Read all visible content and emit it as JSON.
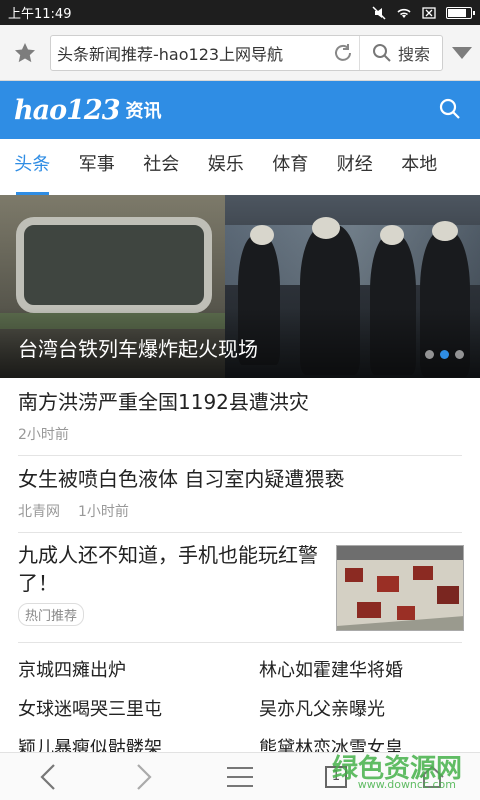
{
  "status": {
    "time": "上午11:49"
  },
  "browser": {
    "url_title": "头条新闻推荐-hao123上网导航",
    "search_label": "搜索"
  },
  "brand": {
    "logo": "hao123",
    "sub": "资讯",
    "accent": "#2f8de4"
  },
  "tabs": [
    {
      "label": "头条",
      "active": true
    },
    {
      "label": "军事"
    },
    {
      "label": "社会"
    },
    {
      "label": "娱乐"
    },
    {
      "label": "体育"
    },
    {
      "label": "财经"
    },
    {
      "label": "本地"
    }
  ],
  "hero": {
    "caption": "台湾台铁列车爆炸起火现场"
  },
  "news": [
    {
      "title": "南方洪涝严重全国1192县遭洪灾",
      "meta": [
        "2小时前"
      ]
    },
    {
      "title": "女生被喷白色液体 自习室内疑遭猥亵",
      "meta": [
        "北青网",
        "1小时前"
      ]
    },
    {
      "title": "九成人还不知道，手机也能玩红警了！",
      "tag": "热门推荐"
    }
  ],
  "links": [
    [
      "京城四瘫出炉",
      "林心如霍建华将婚"
    ],
    [
      "女球迷喝哭三里屯",
      "吴亦凡父亲曝光"
    ],
    [
      "颖儿暴瘦似骷髅架",
      "熊黛林恋冰雪女皇"
    ]
  ],
  "bottom": {
    "tab_count": "1"
  },
  "watermark": {
    "text": "绿色资源网",
    "site": "www.downcc.com"
  }
}
